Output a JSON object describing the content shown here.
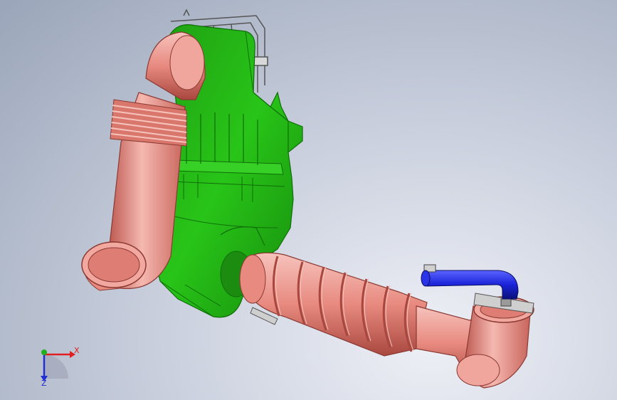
{
  "viewport": {
    "background_top": "#9aa5b9",
    "background_bottom": "#eef0f6"
  },
  "colors": {
    "air_box": "#22b014",
    "air_box_dark": "#0f6f08",
    "hose": "#e88a80",
    "hose_dark": "#a9473f",
    "hose_light": "#f6c3bc",
    "small_pipe": "#1a23d8",
    "metal": "#c9c9c9",
    "x_axis": "#e02020",
    "y_axis": "#20b020",
    "z_axis": "#2030d0"
  },
  "model": {
    "parts": [
      "inlet-elbow-hose",
      "corrugated-bellows",
      "air-filter-box",
      "outlet-corrugated-duct",
      "outlet-elbow-hose",
      "breather-pipe",
      "hose-clamp",
      "mounting-bracket"
    ]
  },
  "triad": {
    "x_label": "X",
    "z_label": "Z",
    "icon": "coordinate-triad-icon"
  }
}
